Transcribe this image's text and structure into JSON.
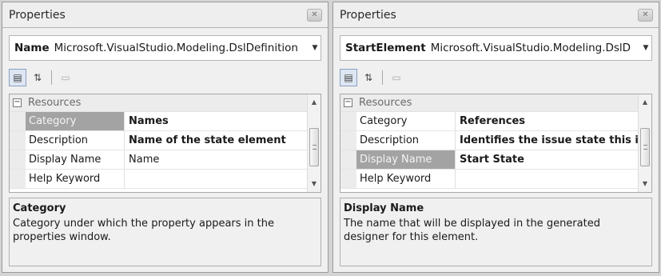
{
  "panels": [
    {
      "title": "Properties",
      "object_name": "Name",
      "object_type": "Microsoft.VisualStudio.Modeling.DslDefinition",
      "category_label": "Resources",
      "rows": [
        {
          "name": "Category",
          "value": "Names",
          "bold": true,
          "selected": true
        },
        {
          "name": "Description",
          "value": "Name of the state element",
          "bold": true,
          "selected": false
        },
        {
          "name": "Display Name",
          "value": "Name",
          "bold": false,
          "selected": false
        },
        {
          "name": "Help Keyword",
          "value": "",
          "bold": false,
          "selected": false
        }
      ],
      "description_title": "Category",
      "description_text": "Category under which the property appears in the properties window."
    },
    {
      "title": "Properties",
      "object_name": "StartElement",
      "object_type": "Microsoft.VisualStudio.Modeling.DslD",
      "category_label": "Resources",
      "rows": [
        {
          "name": "Category",
          "value": "References",
          "bold": true,
          "selected": false
        },
        {
          "name": "Description",
          "value": "Identifies the issue state this is",
          "bold": true,
          "selected": false
        },
        {
          "name": "Display Name",
          "value": "Start State",
          "bold": true,
          "selected": true
        },
        {
          "name": "Help Keyword",
          "value": "",
          "bold": false,
          "selected": false
        }
      ],
      "description_title": "Display Name",
      "description_text": "The name that will be displayed in the generated designer for this element."
    }
  ],
  "icons": {
    "close": "close-icon",
    "categorized": "categorized-view-icon",
    "alphabetical": "alphabetical-sort-icon",
    "property_pages": "property-pages-icon",
    "collapse": "collapse-minus-icon",
    "dropdown": "chevron-down-icon"
  }
}
